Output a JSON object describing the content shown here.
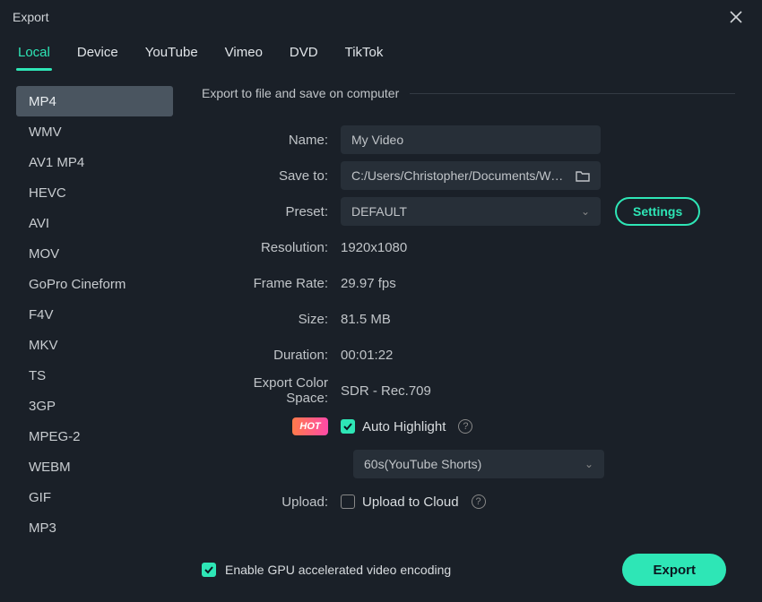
{
  "window": {
    "title": "Export"
  },
  "tabs": [
    "Local",
    "Device",
    "YouTube",
    "Vimeo",
    "DVD",
    "TikTok"
  ],
  "active_tab": 0,
  "formats": [
    "MP4",
    "WMV",
    "AV1 MP4",
    "HEVC",
    "AVI",
    "MOV",
    "GoPro Cineform",
    "F4V",
    "MKV",
    "TS",
    "3GP",
    "MPEG-2",
    "WEBM",
    "GIF",
    "MP3"
  ],
  "active_format": 0,
  "section_title": "Export to file and save on computer",
  "fields": {
    "name_label": "Name:",
    "name_value": "My Video",
    "saveto_label": "Save to:",
    "saveto_value": "C:/Users/Christopher/Documents/Wondersh",
    "preset_label": "Preset:",
    "preset_value": "DEFAULT",
    "settings_button": "Settings",
    "resolution_label": "Resolution:",
    "resolution_value": "1920x1080",
    "framerate_label": "Frame Rate:",
    "framerate_value": "29.97 fps",
    "size_label": "Size:",
    "size_value": "81.5 MB",
    "duration_label": "Duration:",
    "duration_value": "00:01:22",
    "colorspace_label": "Export Color Space:",
    "colorspace_value": "SDR - Rec.709",
    "hot_badge": "HOT",
    "auto_highlight_label": "Auto Highlight",
    "highlight_select_value": "60s(YouTube Shorts)",
    "upload_label": "Upload:",
    "upload_to_cloud_label": "Upload to Cloud"
  },
  "footer": {
    "gpu_label": "Enable GPU accelerated video encoding",
    "export_button": "Export"
  }
}
